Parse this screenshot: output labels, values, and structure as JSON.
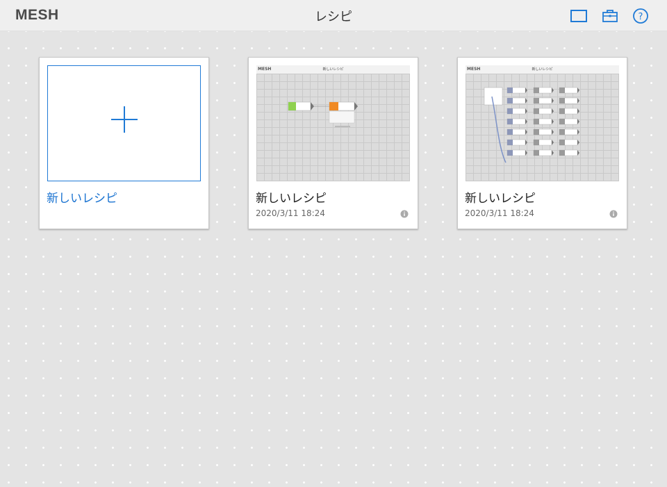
{
  "header": {
    "logo": "MESH",
    "title": "レシピ",
    "icons": [
      "screen-icon",
      "toolbox-icon",
      "help-icon"
    ],
    "accent_color": "#1f7ad6"
  },
  "new_recipe": {
    "label": "新しいレシピ",
    "icon": "plus-icon"
  },
  "recipes": [
    {
      "title": "新しいレシピ",
      "date": "2020/3/11 18:24",
      "thumb_logo": "MESH",
      "thumb_title": "新しいレシピ",
      "info_icon": "info-icon"
    },
    {
      "title": "新しいレシピ",
      "date": "2020/3/11 18:24",
      "thumb_logo": "MESH",
      "thumb_title": "新しいレシピ",
      "info_icon": "info-icon"
    }
  ]
}
